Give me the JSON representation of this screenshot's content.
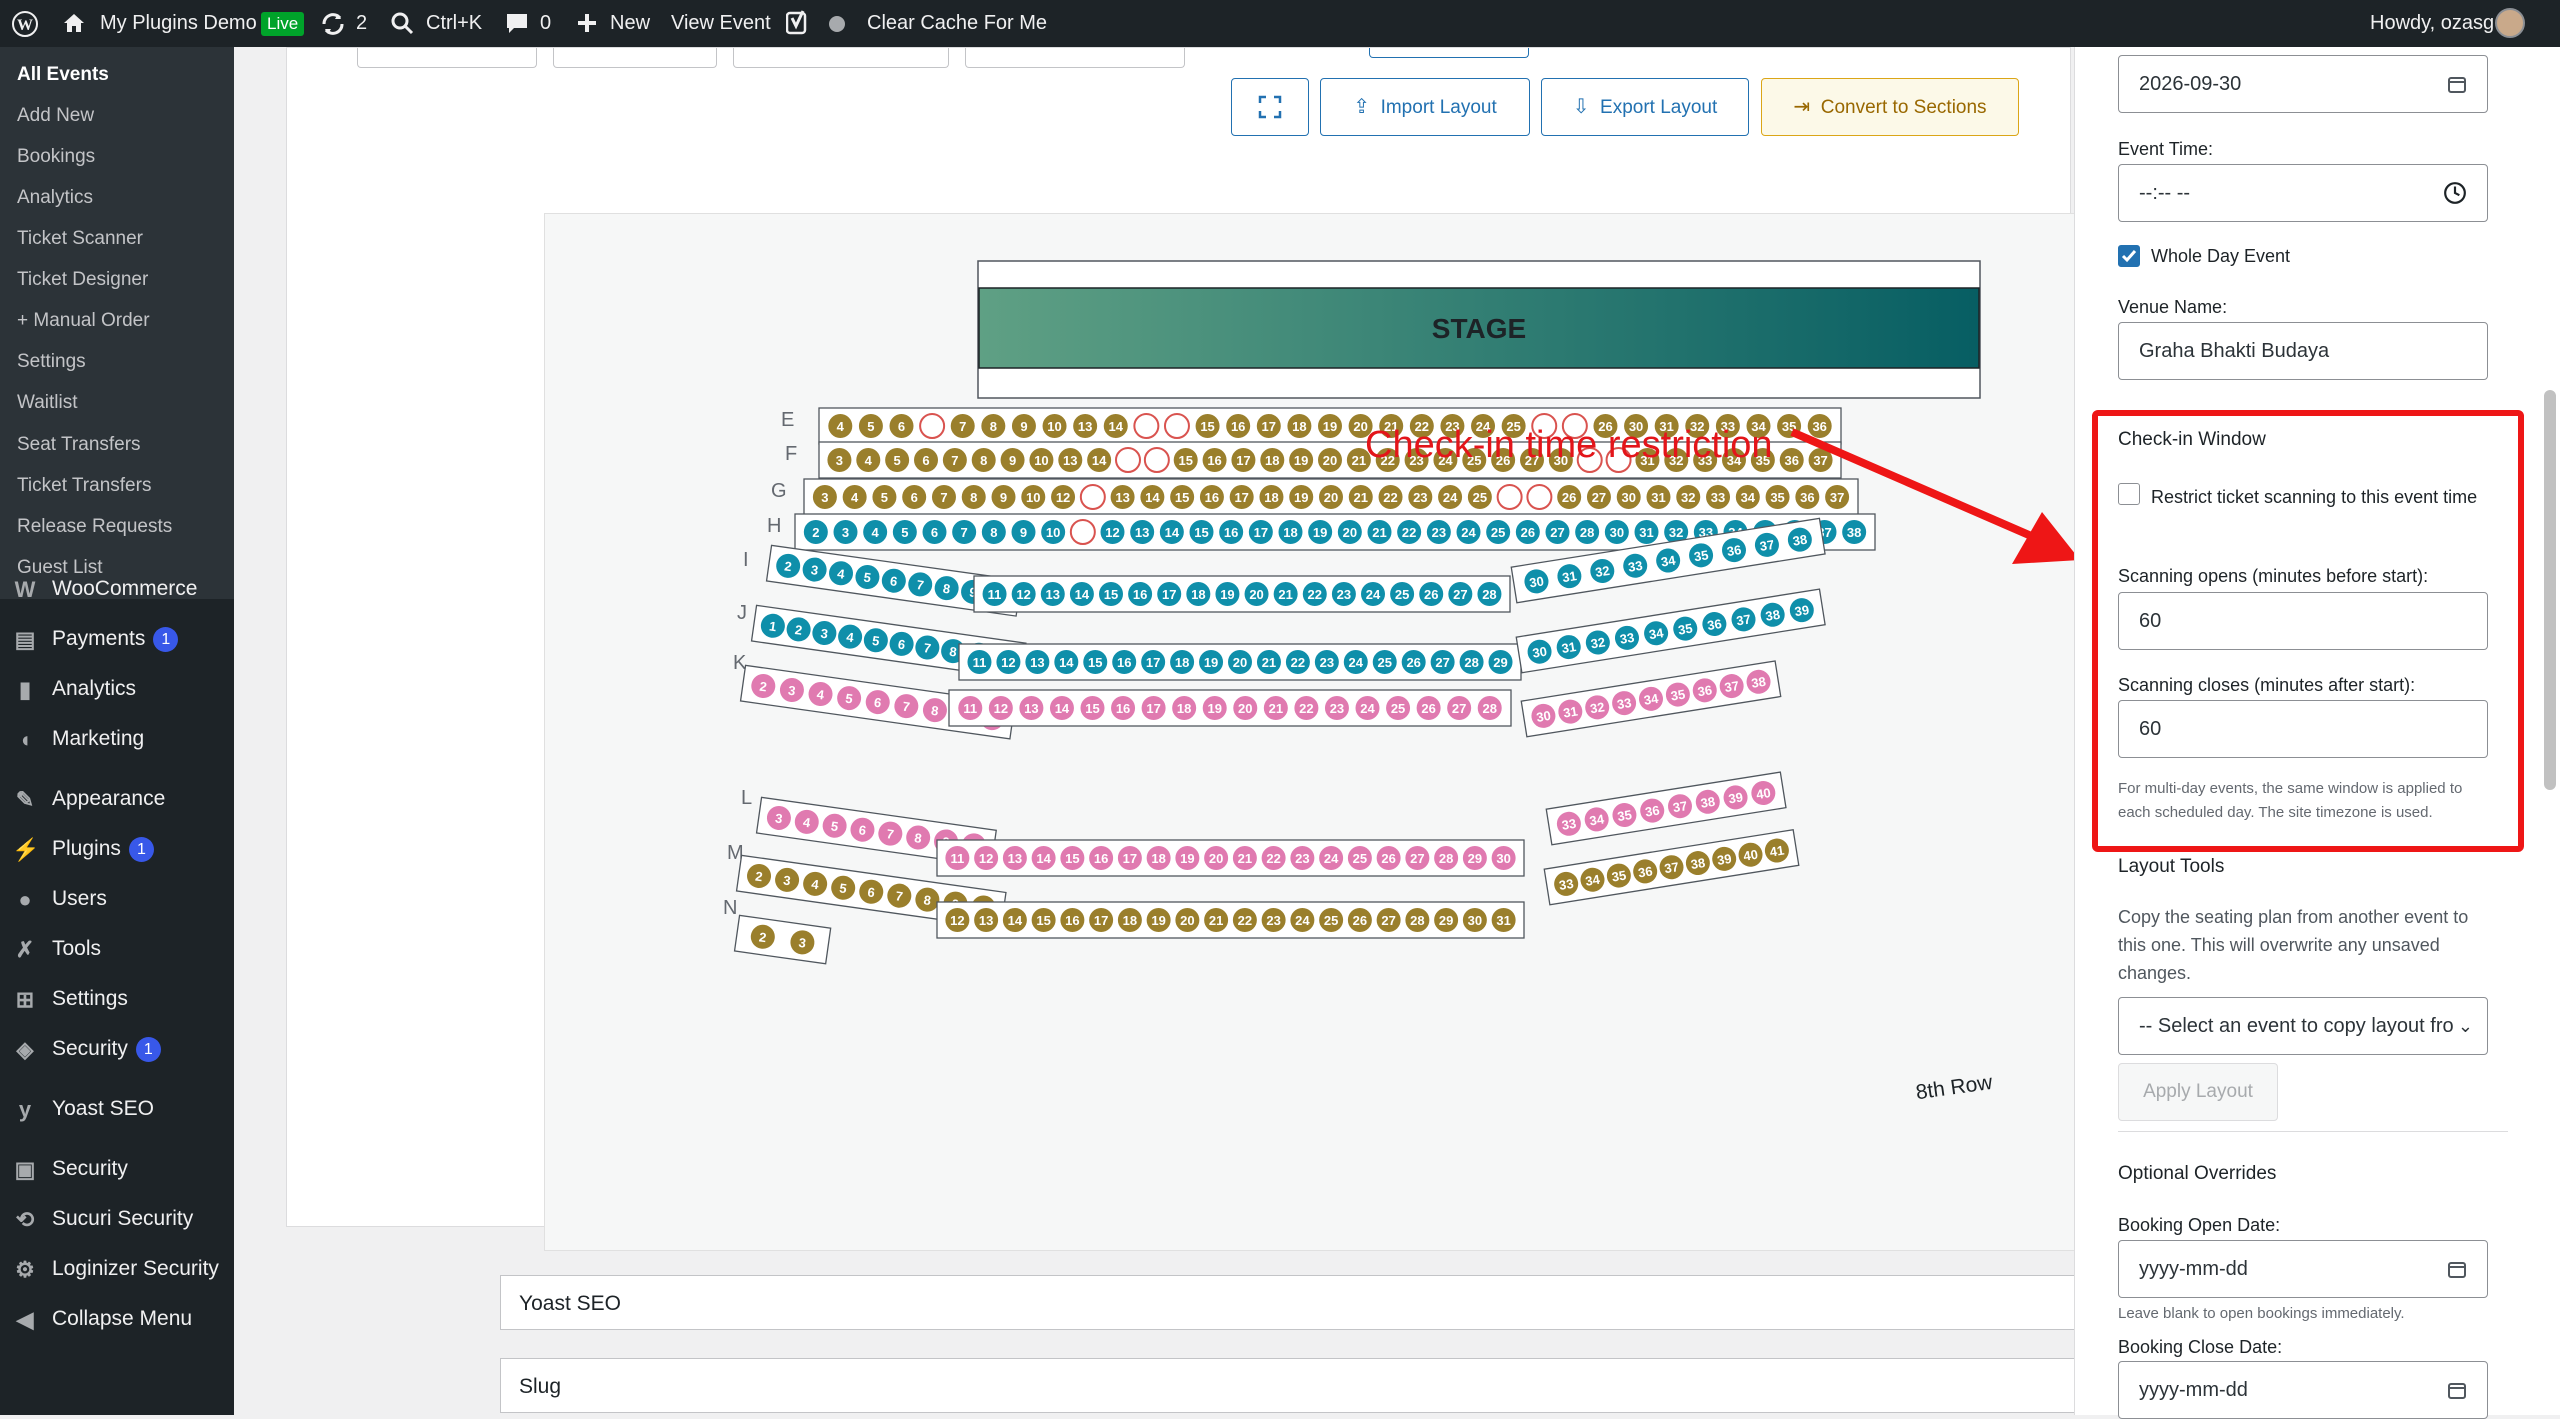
{
  "adminbar": {
    "site_name": "My Plugins Demo",
    "live_label": "Live",
    "updates_count": "2",
    "search_shortcut": "Ctrl+K",
    "comments_count": "0",
    "new_label": "New",
    "view_event_label": "View Event",
    "clear_cache_label": "Clear Cache For Me",
    "howdy": "Howdy, ozasg"
  },
  "sidebar": {
    "submenu": [
      "All Events",
      "Add New",
      "Bookings",
      "Analytics",
      "Ticket Scanner",
      "Ticket Designer",
      "+ Manual Order",
      "Settings",
      "Waitlist",
      "Seat Transfers",
      "Ticket Transfers",
      "Release Requests",
      "Guest List"
    ],
    "menu": [
      {
        "label": "WooCommerce",
        "icon": "woocommerce-icon",
        "count": ""
      },
      {
        "label": "Payments",
        "icon": "payments-icon",
        "count": "1"
      },
      {
        "label": "Analytics",
        "icon": "analytics-icon",
        "count": ""
      },
      {
        "label": "Marketing",
        "icon": "megaphone-icon",
        "count": ""
      },
      {
        "label": "Appearance",
        "icon": "paintbrush-icon",
        "count": ""
      },
      {
        "label": "Plugins",
        "icon": "plugin-icon",
        "count": "1"
      },
      {
        "label": "Users",
        "icon": "users-icon",
        "count": ""
      },
      {
        "label": "Tools",
        "icon": "wrench-icon",
        "count": ""
      },
      {
        "label": "Settings",
        "icon": "settings-icon",
        "count": ""
      },
      {
        "label": "Security",
        "icon": "shield-icon",
        "count": "1"
      },
      {
        "label": "Yoast SEO",
        "icon": "yoast-icon",
        "count": ""
      },
      {
        "label": "Security",
        "icon": "lock-icon",
        "count": ""
      },
      {
        "label": "Sucuri Security",
        "icon": "sucuri-icon",
        "count": ""
      },
      {
        "label": "Loginizer Security",
        "icon": "gear-icon",
        "count": ""
      },
      {
        "label": "Collapse Menu",
        "icon": "collapse-icon",
        "count": ""
      }
    ]
  },
  "toolbar": {
    "import_label": "Import Layout",
    "export_label": "Export Layout",
    "convert_label": "Convert to Sections"
  },
  "seatmap": {
    "stage_label": "STAGE",
    "eighth_row_label": "8th Row",
    "colors": {
      "gold": "#9a7f2c",
      "teal": "#0f8faa",
      "pink": "#e07ab0",
      "empty": "#d9534f"
    },
    "rows": [
      {
        "label": "E",
        "center_seats": [
          "4",
          "5",
          "6",
          "7",
          "8",
          "9",
          "10",
          "13",
          "14",
          "15",
          "16",
          "17",
          "18",
          "19",
          "20",
          "21",
          "22",
          "23",
          "24",
          "25",
          "26",
          "30",
          "31",
          "32",
          "33",
          "34",
          "35",
          "36"
        ]
      },
      {
        "label": "F",
        "center_seats": [
          "3",
          "4",
          "5",
          "6",
          "7",
          "8",
          "9",
          "10",
          "13",
          "14",
          "15",
          "16",
          "17",
          "18",
          "19",
          "20",
          "21",
          "22",
          "23",
          "24",
          "25",
          "26",
          "27",
          "30",
          "31",
          "32",
          "33",
          "34",
          "35",
          "36",
          "37"
        ]
      },
      {
        "label": "G",
        "center_seats": [
          "3",
          "4",
          "5",
          "6",
          "7",
          "8",
          "9",
          "10",
          "12",
          "13",
          "14",
          "15",
          "16",
          "17",
          "18",
          "19",
          "20",
          "21",
          "22",
          "23",
          "24",
          "25",
          "26",
          "27",
          "30",
          "31",
          "32",
          "33",
          "34",
          "35",
          "36",
          "37"
        ]
      },
      {
        "label": "H",
        "center_seats": [
          "2",
          "3",
          "4",
          "5",
          "6",
          "7",
          "8",
          "9",
          "10",
          "12",
          "13",
          "14",
          "15",
          "16",
          "17",
          "18",
          "19",
          "20",
          "21",
          "22",
          "23",
          "24",
          "25",
          "26",
          "27",
          "28",
          "30",
          "31",
          "32",
          "33",
          "34",
          "35",
          "36",
          "37",
          "38"
        ]
      },
      {
        "label": "I",
        "left_seats": [
          "2",
          "3",
          "4",
          "5",
          "6",
          "7",
          "8",
          "9",
          "10"
        ],
        "center_seats": [
          "11",
          "12",
          "13",
          "14",
          "15",
          "16",
          "17",
          "18",
          "19",
          "20",
          "21",
          "22",
          "23",
          "24",
          "25",
          "26",
          "27",
          "28"
        ],
        "right_seats": [
          "30",
          "31",
          "32",
          "33",
          "34",
          "35",
          "36",
          "37",
          "38"
        ]
      },
      {
        "label": "J",
        "left_seats": [
          "1",
          "2",
          "3",
          "4",
          "5",
          "6",
          "7",
          "8",
          "9",
          "10"
        ],
        "center_seats": [
          "11",
          "12",
          "13",
          "14",
          "15",
          "16",
          "17",
          "18",
          "19",
          "20",
          "21",
          "22",
          "23",
          "24",
          "25",
          "26",
          "27",
          "28",
          "29"
        ],
        "right_seats": [
          "30",
          "31",
          "32",
          "33",
          "34",
          "35",
          "36",
          "37",
          "38",
          "39"
        ]
      },
      {
        "label": "K",
        "left_seats": [
          "2",
          "3",
          "4",
          "5",
          "6",
          "7",
          "8",
          "9",
          "10"
        ],
        "center_seats": [
          "11",
          "12",
          "13",
          "14",
          "15",
          "16",
          "17",
          "18",
          "19",
          "20",
          "21",
          "22",
          "23",
          "24",
          "25",
          "26",
          "27",
          "28"
        ],
        "right_seats": [
          "30",
          "31",
          "32",
          "33",
          "34",
          "35",
          "36",
          "37",
          "38"
        ]
      },
      {
        "label": "L",
        "left_seats": [
          "3",
          "4",
          "5",
          "6",
          "7",
          "8",
          "9",
          "10"
        ],
        "center_seats": [
          "11",
          "12",
          "13",
          "14",
          "15",
          "16",
          "17",
          "18",
          "19",
          "20",
          "21",
          "22",
          "23",
          "24",
          "25",
          "26",
          "27",
          "28",
          "29",
          "30"
        ],
        "right_seats": [
          "33",
          "34",
          "35",
          "36",
          "37",
          "38",
          "39",
          "40"
        ]
      },
      {
        "label": "M",
        "left_seats": [
          "2",
          "3",
          "4",
          "5",
          "6",
          "7",
          "8",
          "9",
          "10"
        ],
        "center_seats": [
          "12",
          "13",
          "14",
          "15",
          "16",
          "17",
          "18",
          "19",
          "20",
          "21",
          "22",
          "23",
          "24",
          "25",
          "26",
          "27",
          "28",
          "29",
          "30",
          "31"
        ],
        "right_seats": [
          "33",
          "34",
          "35",
          "36",
          "37",
          "38",
          "39",
          "40",
          "41"
        ]
      },
      {
        "label": "N",
        "left_seats": [
          "2",
          "3"
        ]
      }
    ]
  },
  "annotation": {
    "text": "Check-in time restriction"
  },
  "postboxes": {
    "yoast_title": "Yoast SEO",
    "slug_title": "Slug"
  },
  "rightpanel": {
    "event_date_value": "2026-09-30",
    "event_time_label": "Event Time:",
    "event_time_value": "--:-- --",
    "whole_day_label": "Whole Day Event",
    "venue_label": "Venue Name:",
    "venue_value": "Graha Bhakti Budaya",
    "checkin_title": "Check-in Window",
    "restrict_label": "Restrict ticket scanning to this event time",
    "opens_label": "Scanning opens (minutes before start):",
    "opens_value": "60",
    "closes_label": "Scanning closes (minutes after start):",
    "closes_value": "60",
    "checkin_note": "For multi-day events, the same window is applied to each scheduled day. The site timezone is used.",
    "layout_tools_title": "Layout Tools",
    "layout_tools_desc": "Copy the seating plan from another event to this one. This will overwrite any unsaved changes.",
    "select_placeholder": "-- Select an event to copy layout fro",
    "apply_label": "Apply Layout",
    "overrides_title": "Optional Overrides",
    "booking_open_label": "Booking Open Date:",
    "booking_open_placeholder": "yyyy-mm-dd",
    "booking_open_note": "Leave blank to open bookings immediately.",
    "booking_close_label": "Booking Close Date:",
    "booking_close_placeholder": "yyyy-mm-dd"
  }
}
